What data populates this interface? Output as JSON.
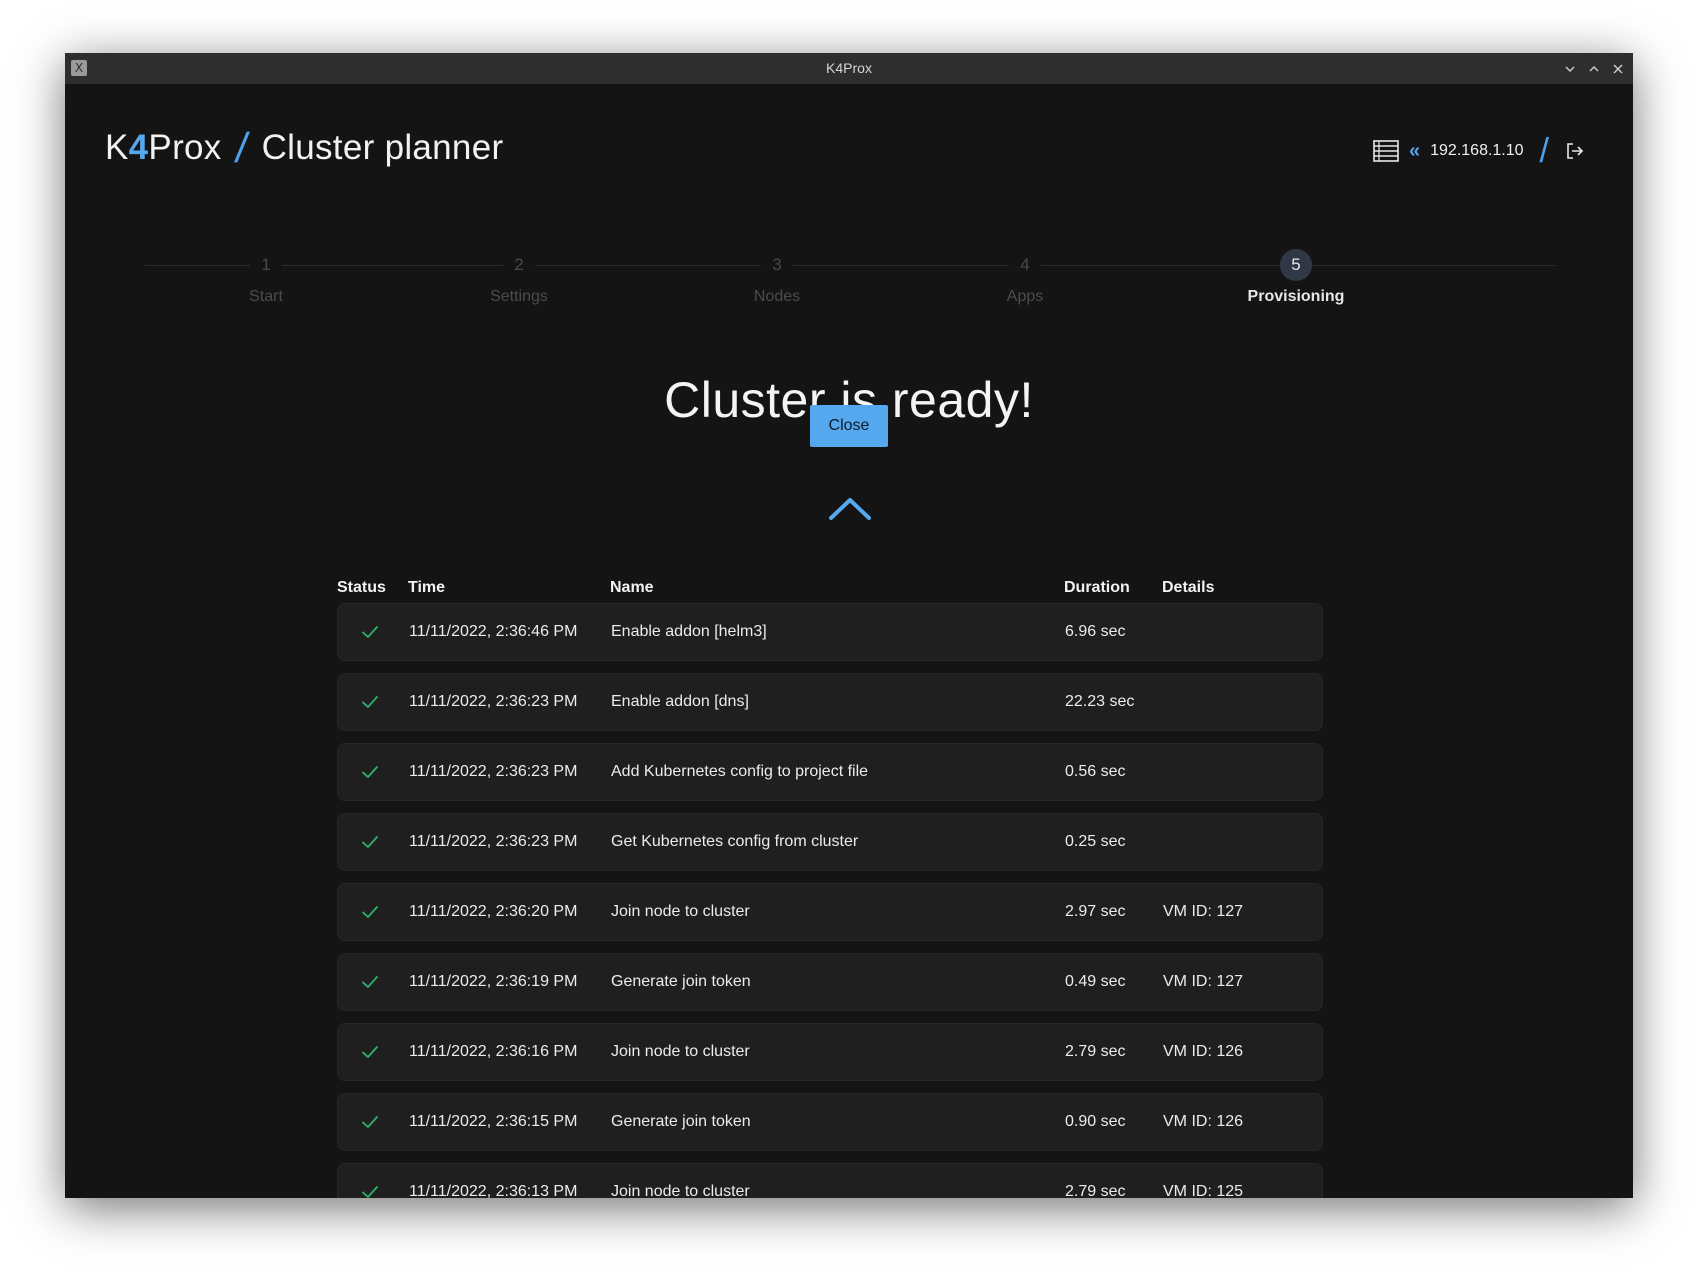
{
  "window": {
    "title": "K4Prox"
  },
  "header": {
    "brand_prefix": "K",
    "brand_accent": "4",
    "brand_suffix": "Prox",
    "page_title": "Cluster planner",
    "host_ip": "192.168.1.10"
  },
  "stepper": {
    "active_step": 5,
    "steps": [
      {
        "number": "1",
        "label": "Start"
      },
      {
        "number": "2",
        "label": "Settings"
      },
      {
        "number": "3",
        "label": "Nodes"
      },
      {
        "number": "4",
        "label": "Apps"
      },
      {
        "number": "5",
        "label": "Provisioning"
      }
    ]
  },
  "main": {
    "heading": "Cluster is ready!",
    "close_label": "Close"
  },
  "table": {
    "headers": {
      "status": "Status",
      "time": "Time",
      "name": "Name",
      "duration": "Duration",
      "details": "Details"
    },
    "rows": [
      {
        "status": "success",
        "time": "11/11/2022, 2:36:46 PM",
        "name": "Enable addon [helm3]",
        "duration": "6.96 sec",
        "details": ""
      },
      {
        "status": "success",
        "time": "11/11/2022, 2:36:23 PM",
        "name": "Enable addon [dns]",
        "duration": "22.23 sec",
        "details": ""
      },
      {
        "status": "success",
        "time": "11/11/2022, 2:36:23 PM",
        "name": "Add Kubernetes config to project file",
        "duration": "0.56 sec",
        "details": ""
      },
      {
        "status": "success",
        "time": "11/11/2022, 2:36:23 PM",
        "name": "Get Kubernetes config from cluster",
        "duration": "0.25 sec",
        "details": ""
      },
      {
        "status": "success",
        "time": "11/11/2022, 2:36:20 PM",
        "name": "Join node to cluster",
        "duration": "2.97 sec",
        "details": "VM ID: 127"
      },
      {
        "status": "success",
        "time": "11/11/2022, 2:36:19 PM",
        "name": "Generate join token",
        "duration": "0.49 sec",
        "details": "VM ID: 127"
      },
      {
        "status": "success",
        "time": "11/11/2022, 2:36:16 PM",
        "name": "Join node to cluster",
        "duration": "2.79 sec",
        "details": "VM ID: 126"
      },
      {
        "status": "success",
        "time": "11/11/2022, 2:36:15 PM",
        "name": "Generate join token",
        "duration": "0.90 sec",
        "details": "VM ID: 126"
      },
      {
        "status": "success",
        "time": "11/11/2022, 2:36:13 PM",
        "name": "Join node to cluster",
        "duration": "2.79 sec",
        "details": "VM ID: 125"
      }
    ]
  },
  "colors": {
    "accent": "#55a8ee",
    "success": "#2fb36a",
    "background": "#141414",
    "row_background": "#1f1f1f"
  },
  "icons": {
    "app": "x-window-icon",
    "servers": "server-list-icon",
    "back": "double-chevron-left-icon",
    "logout": "logout-icon",
    "collapse": "chevron-up-icon",
    "status_success": "check-icon"
  }
}
